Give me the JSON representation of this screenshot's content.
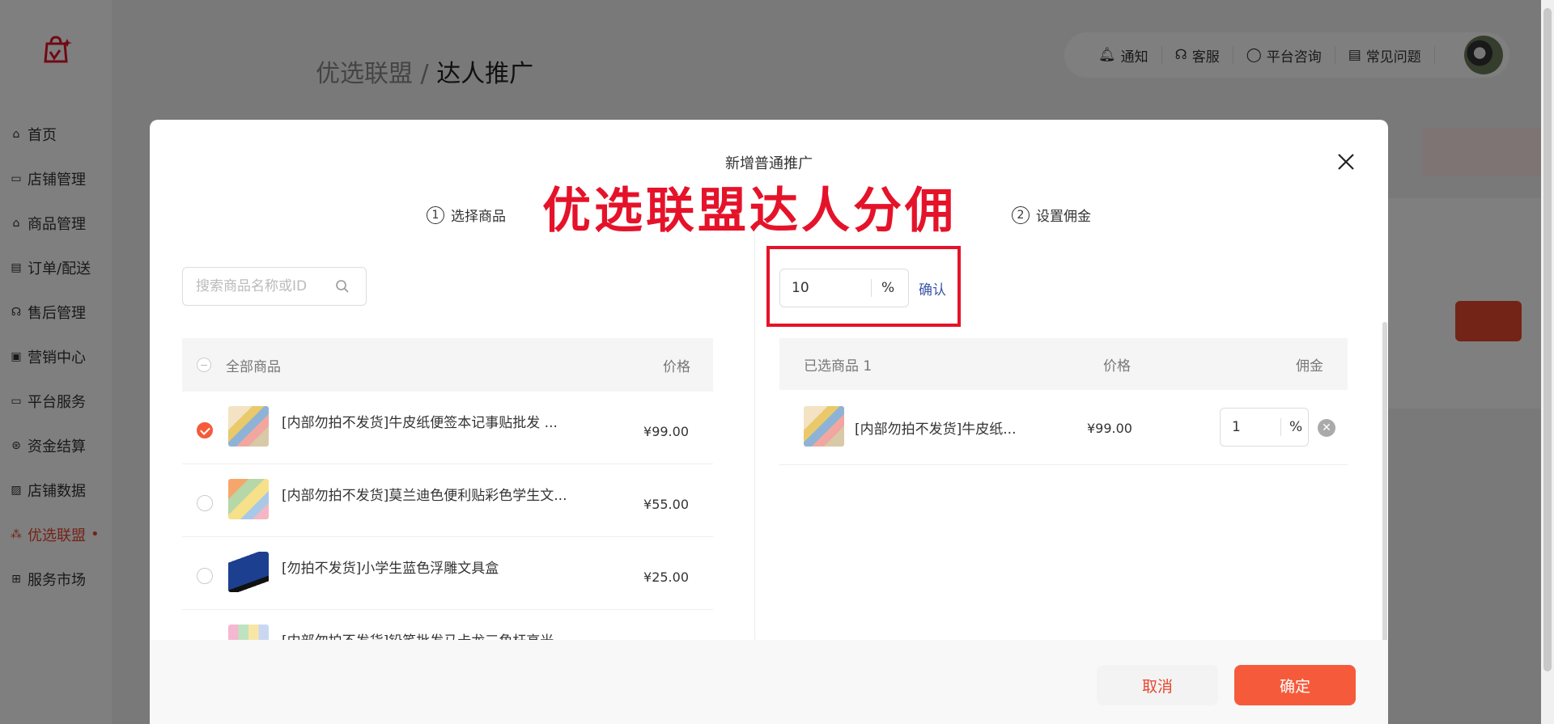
{
  "sidebar": {
    "items": [
      {
        "icon": "home-icon",
        "label": "首页"
      },
      {
        "icon": "store-icon",
        "label": "店铺管理"
      },
      {
        "icon": "bag-icon",
        "label": "商品管理"
      },
      {
        "icon": "order-icon",
        "label": "订单/配送"
      },
      {
        "icon": "headset-icon",
        "label": "售后管理"
      },
      {
        "icon": "marketing-icon",
        "label": "营销中心"
      },
      {
        "icon": "briefcase-icon",
        "label": "平台服务"
      },
      {
        "icon": "yen-icon",
        "label": "资金结算"
      },
      {
        "icon": "chart-icon",
        "label": "店铺数据"
      },
      {
        "icon": "network-icon",
        "label": "优选联盟",
        "dot": "•"
      },
      {
        "icon": "grid-icon",
        "label": "服务市场"
      }
    ],
    "active_index": 9
  },
  "breadcrumb": {
    "parent": "优选联盟",
    "separator": " / ",
    "current": "达人推广"
  },
  "topbar": {
    "items": [
      {
        "icon": "bell-icon",
        "label": "通知"
      },
      {
        "icon": "headset-icon",
        "label": "客服"
      },
      {
        "icon": "chat-icon",
        "label": "平台咨询"
      },
      {
        "icon": "document-icon",
        "label": "常见问题"
      }
    ]
  },
  "modal": {
    "title": "新增普通推广",
    "banner": "优选联盟达人分佣",
    "step1": {
      "num": "1",
      "label": "选择商品"
    },
    "step2": {
      "num": "2",
      "label": "设置佣金"
    },
    "search_placeholder": "搜索商品名称或ID",
    "left_header": {
      "name": "全部商品",
      "price": "价格"
    },
    "products": [
      {
        "name": "[内部勿拍不发货]牛皮纸便签本记事贴批发 ...",
        "price": "¥99.00",
        "checked": true
      },
      {
        "name": "[内部勿拍不发货]莫兰迪色便利贴彩色学生文...",
        "price": "¥55.00",
        "checked": false
      },
      {
        "name": "[勿拍不发货]小学生蓝色浮雕文具盒",
        "price": "¥25.00",
        "checked": false
      },
      {
        "name": "[内部勿拍不发货]铅笔批发马卡龙三角杆高光",
        "price": "",
        "checked": false
      }
    ],
    "rate_value": "10",
    "rate_unit": "%",
    "rate_confirm": "确认",
    "right_header": {
      "name": "已选商品 1",
      "price": "价格",
      "commission": "佣金"
    },
    "selected": [
      {
        "name": "[内部勿拍不发货]牛皮纸...",
        "price": "¥99.00",
        "commission": "1",
        "unit": "%"
      }
    ],
    "cancel_label": "取消",
    "ok_label": "确定"
  },
  "colors": {
    "accent": "#f55b3b",
    "banner": "#e5132a",
    "link": "#3a56a8"
  }
}
